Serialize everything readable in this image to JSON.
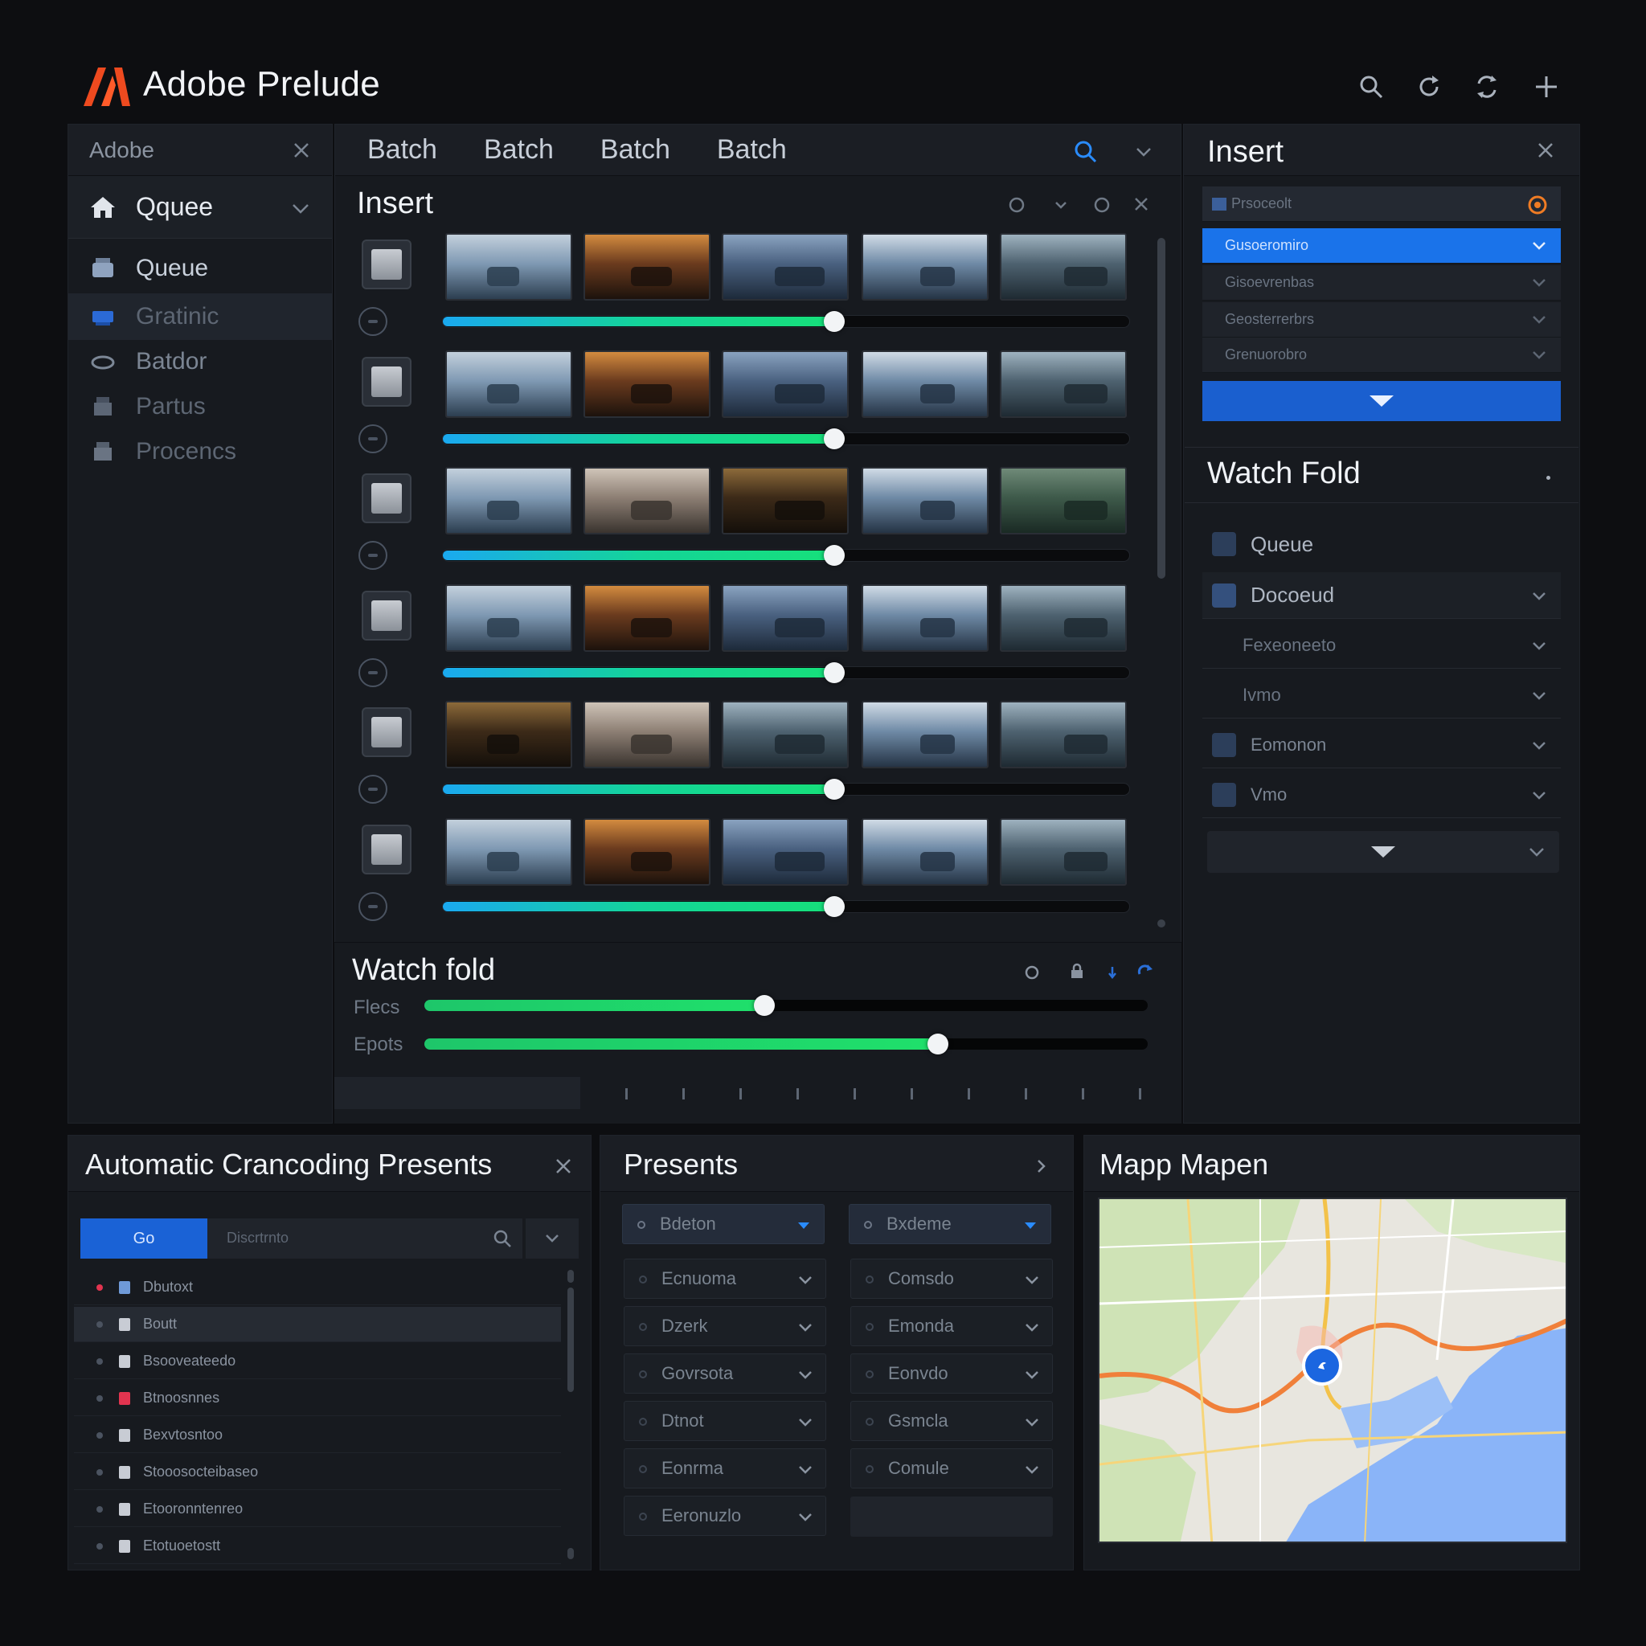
{
  "app": {
    "title": "Adobe Prelude"
  },
  "top_tools": [
    "search-icon",
    "refresh-icon",
    "sync-icon",
    "add-icon"
  ],
  "left_panel": {
    "header": "Adobe",
    "section": "Qquee",
    "items": [
      {
        "label": "Queue",
        "icon": "queue-icon"
      },
      {
        "label": "Gratinic",
        "icon": "tray-icon",
        "selected": true
      },
      {
        "label": "Batdor",
        "icon": "batch-icon"
      },
      {
        "label": "Partus",
        "icon": "package-icon"
      },
      {
        "label": "Procencs",
        "icon": "process-icon"
      }
    ]
  },
  "center": {
    "tabs": [
      "Batch",
      "Batch",
      "Batch",
      "Batch"
    ],
    "insert_title": "Insert",
    "progress": [
      0.57,
      0.57,
      0.57,
      0.57,
      0.57,
      0.57
    ],
    "watch_fold": {
      "title": "Watch fold",
      "sliders": [
        {
          "label": "Flecs",
          "value": 0.47
        },
        {
          "label": "Epots",
          "value": 0.71
        }
      ]
    }
  },
  "right_panel": {
    "insert_title": "Insert",
    "dropdown_rows": [
      "Prsoceolt",
      "Gusoeromiro",
      "Gisoevrenbas",
      "Geosterrerbrs",
      "Grenuorobro"
    ],
    "watch_fold_title": "Watch Fold",
    "watch_fold_items": [
      "Queue",
      "Docoeud",
      "Fexeoneeto",
      "Ivmo",
      "Eomonon",
      "Vmo"
    ]
  },
  "auto_panel": {
    "title": "Automatic Crancoding Presents",
    "search_button": "Go",
    "search_placeholder": "Discrtrnto",
    "rows": [
      "Dbutoxt",
      "Boutt",
      "Bsooveateedo",
      "Btnoosnnes",
      "Bexvtosntoo",
      "Stooosocteibaseo",
      "Etooronntenreo",
      "Etotuoetostt"
    ]
  },
  "presets_panel": {
    "title": "Presents",
    "head_left": "Bdeton",
    "head_right": "Bxdeme",
    "left": [
      "Ecnuoma",
      "Dzerk",
      "Govrsota",
      "Dtnot",
      "Eonrma",
      "Eeronuzlo"
    ],
    "right": [
      "Comsdo",
      "Emonda",
      "Eonvdo",
      "Gsmcla",
      "Comule"
    ]
  },
  "map_panel": {
    "title": "Mapp Mapen"
  },
  "colors": {
    "accent": "#1d6fe0",
    "progress_start": "#1aa9f0",
    "progress_end": "#16e07a",
    "logo": "#ee4a1f"
  }
}
